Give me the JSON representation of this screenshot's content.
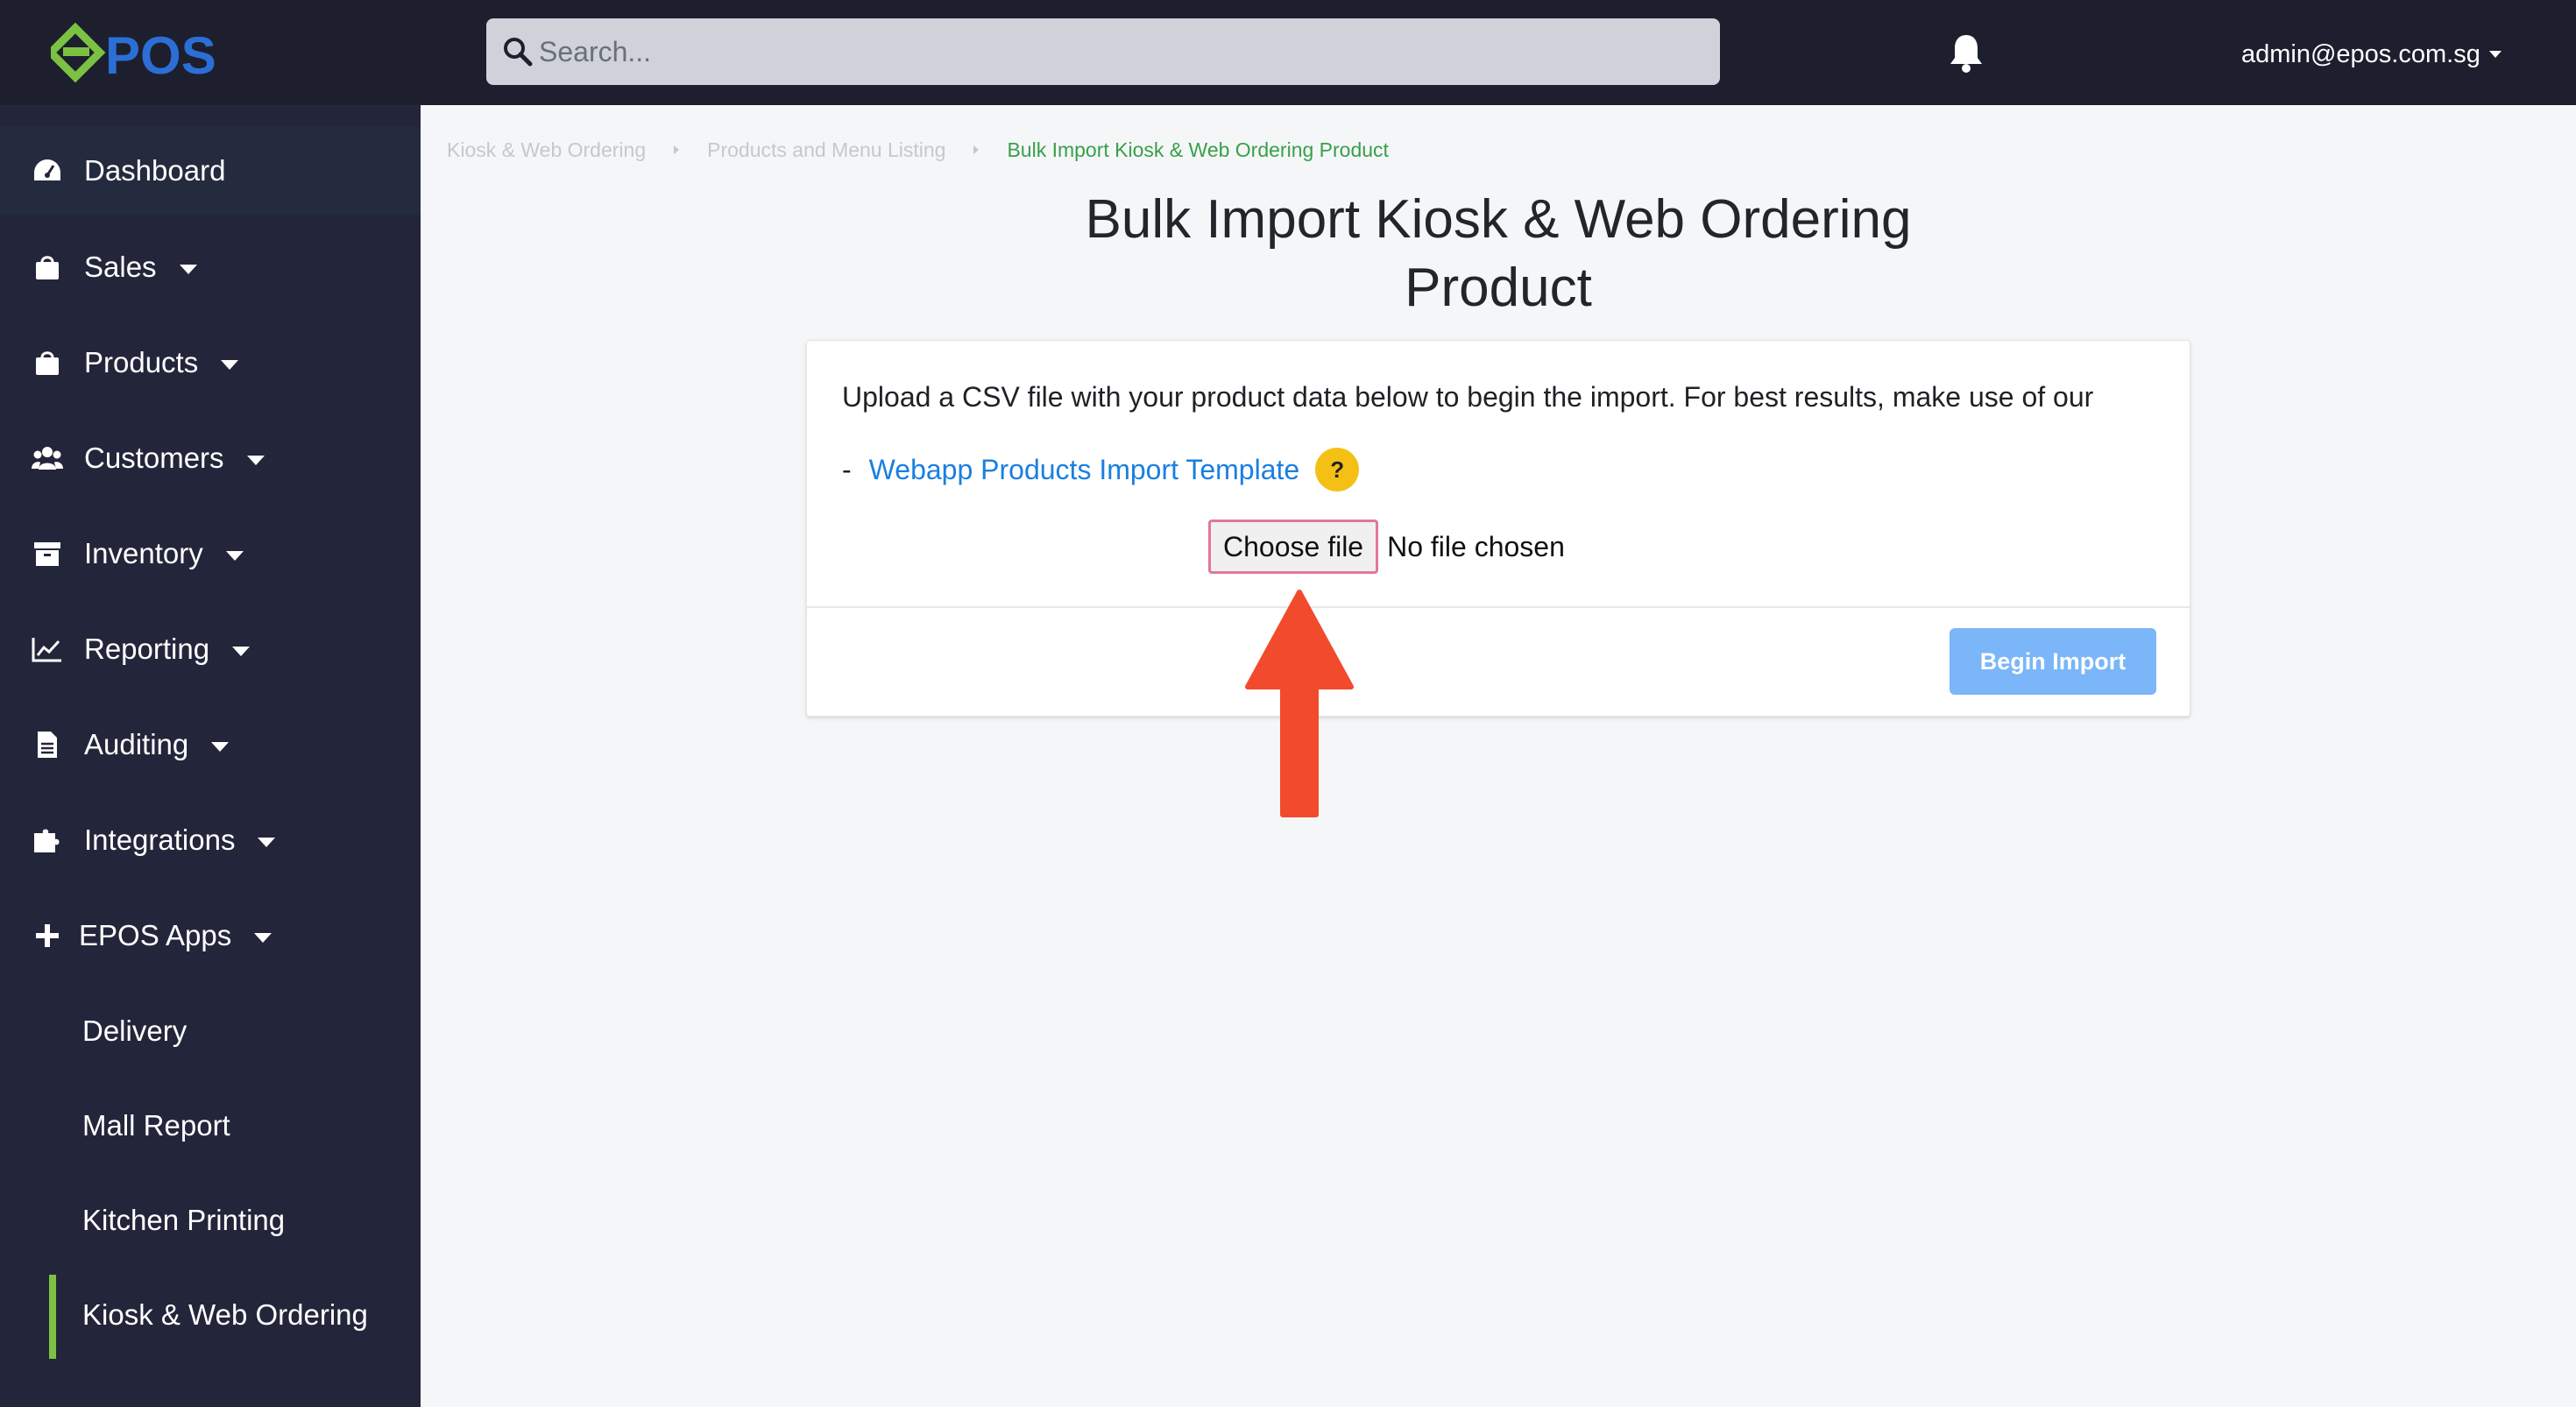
{
  "brand": {
    "logo_text": "POS",
    "accent_color": "#7cc242",
    "logo_blue": "#2b6fd6"
  },
  "topbar": {
    "search_placeholder": "Search...",
    "user_email": "admin@epos.com.sg"
  },
  "sidebar": {
    "items": [
      {
        "label": "Dashboard",
        "icon": "dashboard-icon"
      },
      {
        "label": "Sales",
        "icon": "shopping-bag-icon"
      },
      {
        "label": "Products",
        "icon": "shopping-bag-icon"
      },
      {
        "label": "Customers",
        "icon": "users-icon"
      },
      {
        "label": "Inventory",
        "icon": "archive-icon"
      },
      {
        "label": "Reporting",
        "icon": "line-chart-icon"
      },
      {
        "label": "Auditing",
        "icon": "document-icon"
      },
      {
        "label": "Integrations",
        "icon": "puzzle-icon"
      },
      {
        "label": "EPOS Apps",
        "icon": "plus-icon"
      }
    ],
    "sub_items": [
      {
        "label": "Delivery"
      },
      {
        "label": "Mall Report"
      },
      {
        "label": "Kitchen Printing"
      },
      {
        "label": "Kiosk & Web Ordering",
        "active": true
      }
    ]
  },
  "breadcrumb": [
    "Kiosk & Web Ordering",
    "Products and Menu Listing",
    "Bulk Import Kiosk & Web Ordering Product"
  ],
  "page": {
    "title_line1": "Bulk Import Kiosk & Web Ordering",
    "title_line2": "Product"
  },
  "card": {
    "intro": "Upload a CSV file with your product data below to begin the import. For best results, make use of our",
    "dash": "-",
    "template_link": "Webapp Products Import Template",
    "help_badge": "?",
    "choose_file": "Choose file",
    "file_status": "No file chosen",
    "begin_import": "Begin Import"
  },
  "colors": {
    "topbar_bg": "#1d1f2e",
    "sidebar_bg": "#23263a",
    "link": "#1a7fe0",
    "breadcrumb_current": "#37a04a",
    "begin_button": "#7ab6f8",
    "help_badge": "#f5c016",
    "annotation_arrow": "#f24a2c"
  }
}
